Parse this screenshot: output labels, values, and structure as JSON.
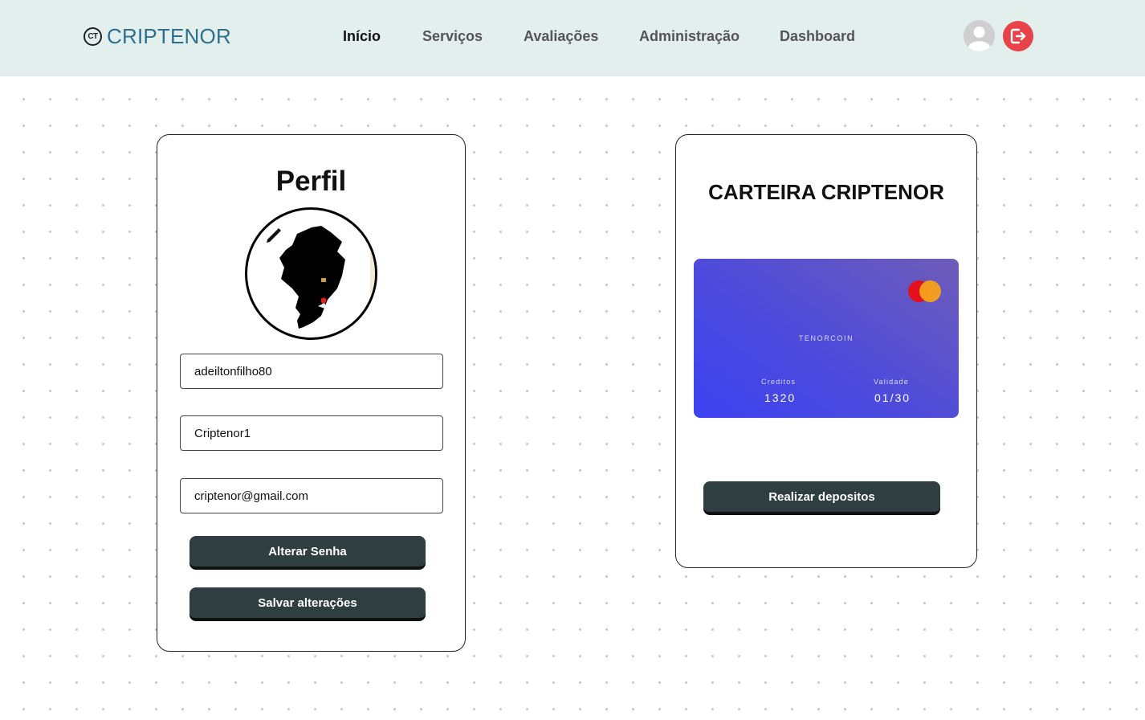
{
  "navbar": {
    "brand_logo": "CT",
    "brand_name": "CRIPTENOR",
    "links": [
      {
        "label": "Início",
        "active": true
      },
      {
        "label": "Serviços",
        "active": false
      },
      {
        "label": "Avaliações",
        "active": false
      },
      {
        "label": "Administração",
        "active": false
      },
      {
        "label": "Dashboard",
        "active": false
      }
    ],
    "avatar_icon": "user-avatar-icon",
    "logout_icon": "logout-icon"
  },
  "profile": {
    "title": "Perfil",
    "photo_icon": "map-silhouette-image",
    "edit_icon": "pencil-icon",
    "username": "adeiltonfilho80",
    "password": "Criptenor1",
    "email": "criptenor@gmail.com",
    "change_password_label": "Alterar Senha",
    "save_label": "Salvar alterações"
  },
  "wallet": {
    "title": "CARTEIRA CRIPTENOR",
    "card": {
      "brand_text": "TENORCOIN",
      "credits_label": "Creditos",
      "credits_value": "1320",
      "validity_label": "Validade",
      "validity_value": "01/30",
      "network_icon": "mastercard-icon"
    },
    "deposit_label": "Realizar depositos"
  },
  "colors": {
    "navbar_bg": "#e3efec",
    "brand": "#2d6f8e",
    "button": "#2f3e40",
    "logout": "#e8424a",
    "card_gradient_start": "#3b41f0",
    "card_gradient_end": "#6e5cb8"
  }
}
